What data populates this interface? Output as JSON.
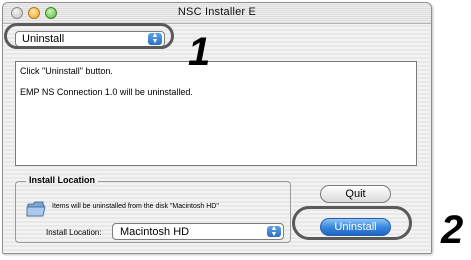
{
  "window": {
    "title": "NSC Installer E"
  },
  "mode_popup": {
    "selected": "Uninstall",
    "arrows": "▲▼"
  },
  "callouts": {
    "step1": "1",
    "step2": "2"
  },
  "messages": [
    "Click \"Uninstall\" button.",
    "EMP NS Connection 1.0 will be uninstalled."
  ],
  "install_location": {
    "title": "Install Location",
    "description": "Items will be uninstalled from the disk \"Macintosh HD\"",
    "label": "Install Location:",
    "disk": "Macintosh HD"
  },
  "buttons": {
    "quit": "Quit",
    "uninstall": "Uninstall"
  },
  "colors": {
    "accent": "#2d6fc7",
    "highlight_ring": "#5a5a5a"
  }
}
